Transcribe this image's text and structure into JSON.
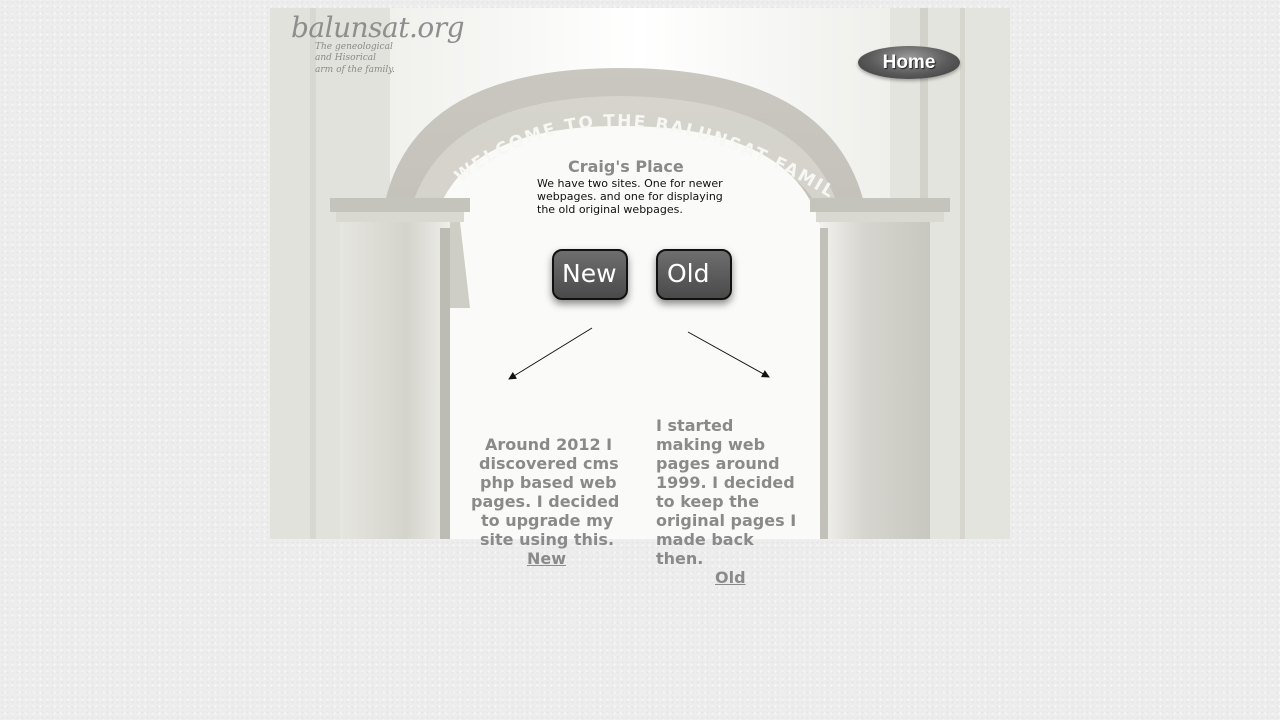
{
  "logo": {
    "text": "balunsat.org",
    "tagline": [
      "The geneological",
      "and Hisorical",
      "arm of the family."
    ]
  },
  "banner": {
    "arch_text": "WELCOME TO THE BALUNSAT FAMILY ORG."
  },
  "nav": {
    "home_label": "Home"
  },
  "intro": {
    "title": "Craig's Place",
    "lines": [
      "We have two sites. One for  newer",
      "webpages. and one  for displaying",
      "the old original webpages."
    ]
  },
  "buttons": {
    "new_label": "New",
    "old_label": "Old"
  },
  "left_column": {
    "lines": [
      "Around 2012 I",
      "discovered cms",
      "php based web",
      "pages.  I decided",
      "to upgrade my",
      "site using this."
    ],
    "link": "New"
  },
  "right_column": {
    "lines": [
      "I started",
      "making web",
      "pages around",
      "1999. I decided",
      "to keep the",
      "original pages I",
      "made back",
      "then."
    ],
    "link": "Old"
  },
  "colors": {
    "text_gray": "#8a8a8a",
    "button_dark": "#4a4a4a"
  }
}
